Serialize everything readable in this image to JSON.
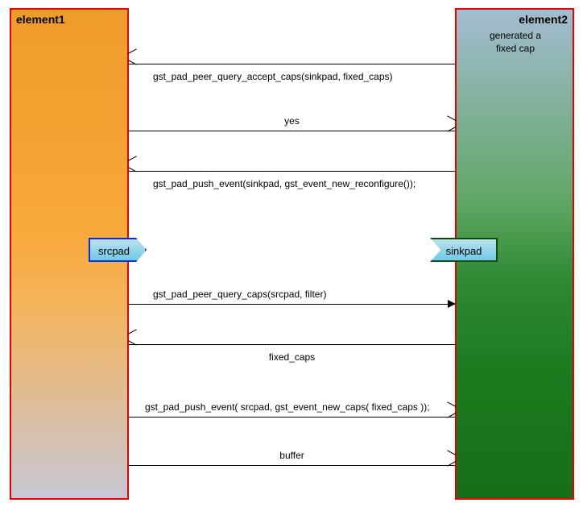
{
  "elements": {
    "left": "element1",
    "right": "element2"
  },
  "pads": {
    "src": "srcpad",
    "sink": "sinkpad"
  },
  "note_right": {
    "line1": "generated a",
    "line2": "fixed cap"
  },
  "messages": {
    "m1_label": "gst_pad_peer_query_accept_caps(sinkpad, fixed_caps)",
    "m2_label": "yes",
    "m3_label": "gst_pad_push_event(sinkpad, gst_event_new_reconfigure());",
    "m4_label": "gst_pad_peer_query_caps(srcpad, filter)",
    "m5_label": "fixed_caps",
    "m6_label": "gst_pad_push_event( srcpad, gst_event_new_caps( fixed_caps ));",
    "m7_label": "buffer"
  },
  "chart_data": {
    "type": "sequence-diagram",
    "participants": [
      {
        "id": "element1",
        "label": "element1",
        "pad": "srcpad"
      },
      {
        "id": "element2",
        "label": "element2",
        "pad": "sinkpad"
      }
    ],
    "notes": [
      {
        "over": "element2",
        "text": "generated a fixed cap"
      }
    ],
    "messages": [
      {
        "from": "element2",
        "to": "element1",
        "label": "gst_pad_peer_query_accept_caps(sinkpad, fixed_caps)",
        "style": "open",
        "kind": "call"
      },
      {
        "from": "element1",
        "to": "element2",
        "label": "yes",
        "style": "open",
        "kind": "return"
      },
      {
        "from": "element2",
        "to": "element1",
        "label": "gst_pad_push_event(sinkpad, gst_event_new_reconfigure());",
        "style": "open",
        "kind": "call"
      },
      {
        "from": "element1",
        "to": "element2",
        "label": "gst_pad_peer_query_caps(srcpad, filter)",
        "style": "filled",
        "kind": "call"
      },
      {
        "from": "element2",
        "to": "element1",
        "label": "fixed_caps",
        "style": "open",
        "kind": "return"
      },
      {
        "from": "element1",
        "to": "element2",
        "label": "gst_pad_push_event( srcpad, gst_event_new_caps( fixed_caps ));",
        "style": "open",
        "kind": "call"
      },
      {
        "from": "element1",
        "to": "element2",
        "label": "buffer",
        "style": "open",
        "kind": "message"
      }
    ]
  }
}
